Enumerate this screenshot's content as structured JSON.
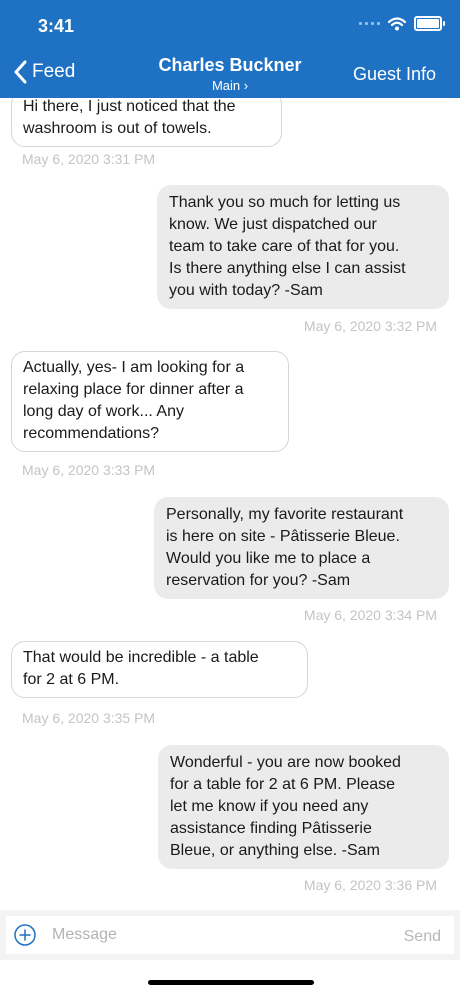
{
  "status_bar": {
    "time": "3:41"
  },
  "nav": {
    "back_label": "Feed",
    "title": "Charles Buckner",
    "subtitle": "Main ›",
    "right_label": "Guest Info"
  },
  "messages": [
    {
      "from": "guest",
      "lines": [
        "Hi there, I just noticed that the",
        "washroom is out of towels."
      ],
      "time": "May 6, 2020  3:31 PM"
    },
    {
      "from": "staff",
      "lines": [
        "Thank you so much for letting us",
        "know. We just dispatched our",
        "team to take care of that for you.",
        "Is there anything else I can assist",
        "you with today? -Sam"
      ],
      "time": "May 6, 2020  3:32 PM"
    },
    {
      "from": "guest",
      "lines": [
        "Actually, yes- I am looking for a",
        "relaxing place for dinner after a",
        "long day of work... Any",
        "recommendations?"
      ],
      "time": "May 6, 2020  3:33 PM"
    },
    {
      "from": "staff",
      "lines": [
        "Personally, my favorite restaurant",
        "is here on site - Pâtisserie Bleue.",
        "Would you like me to place a",
        "reservation for you? -Sam"
      ],
      "time": "May 6, 2020  3:34 PM"
    },
    {
      "from": "guest",
      "lines": [
        "That would be incredible - a table",
        "for 2 at 6 PM."
      ],
      "time": "May 6, 2020  3:35 PM"
    },
    {
      "from": "staff",
      "lines": [
        "Wonderful - you are now booked",
        "for a table for 2 at 6 PM. Please",
        "let me know if you need any",
        "assistance finding Pâtisserie",
        "Bleue, or anything else. -Sam"
      ],
      "time": "May 6, 2020  3:36 PM"
    }
  ],
  "composer": {
    "placeholder": "Message",
    "send_label": "Send"
  }
}
